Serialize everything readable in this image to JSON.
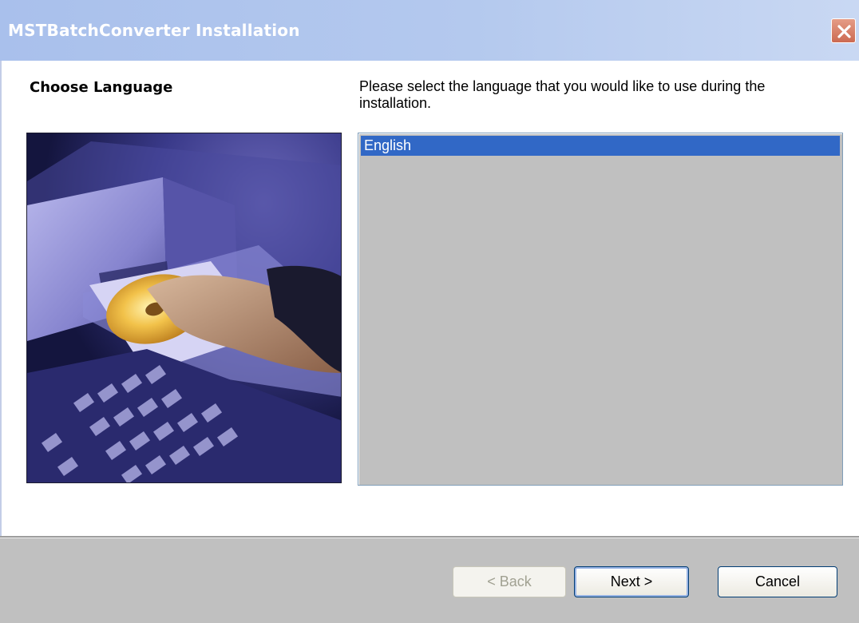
{
  "window": {
    "title": "MSTBatchConverter Installation"
  },
  "page": {
    "heading": "Choose Language",
    "instruction": "Please select the language that you would like to use during the installation."
  },
  "language_list": {
    "items": [
      {
        "label": "English",
        "selected": true
      }
    ]
  },
  "buttons": {
    "back": {
      "label": "< Back",
      "enabled": false
    },
    "next": {
      "label": "Next >",
      "enabled": true
    },
    "cancel": {
      "label": "Cancel",
      "enabled": true
    }
  },
  "colors": {
    "titlebar": "#b4c9ee",
    "selection": "#3168c6",
    "panel": "#c0c0c0",
    "close_button": "#d9806a"
  },
  "icons": {
    "close": "close-icon"
  }
}
